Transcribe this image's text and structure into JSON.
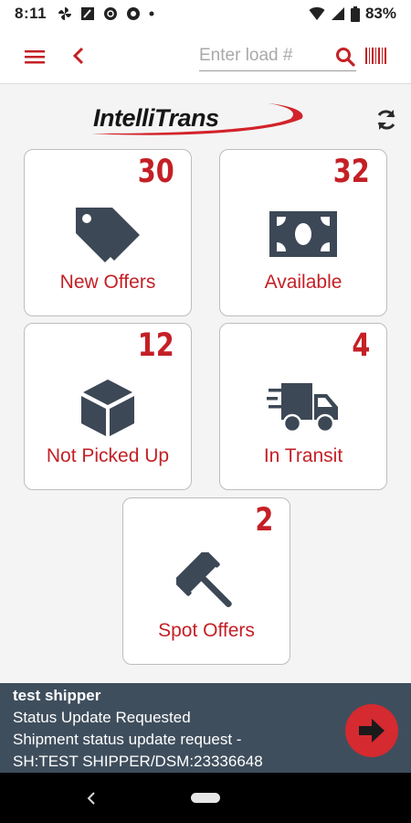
{
  "status_bar": {
    "time": "8:11",
    "battery": "83%"
  },
  "toolbar": {
    "search_placeholder": "Enter load #",
    "search_value": ""
  },
  "logo": {
    "text": "IntelliTrans"
  },
  "tiles": [
    {
      "label": "New Offers",
      "count": "30",
      "icon": "tags-icon"
    },
    {
      "label": "Available",
      "count": "32",
      "icon": "money-icon"
    },
    {
      "label": "Not Picked Up",
      "count": "12",
      "icon": "box-icon"
    },
    {
      "label": "In Transit",
      "count": "4",
      "icon": "truck-icon"
    },
    {
      "label": "Spot Offers",
      "count": "2",
      "icon": "gavel-icon"
    }
  ],
  "notification": {
    "title": "test shipper",
    "line1": "Status Update Requested",
    "line2": "Shipment status update request -",
    "line3": "SH:TEST SHIPPER/DSM:23336648"
  },
  "colors": {
    "accent": "#c42026",
    "icon": "#3d4856",
    "banner": "#3f4e5d"
  }
}
